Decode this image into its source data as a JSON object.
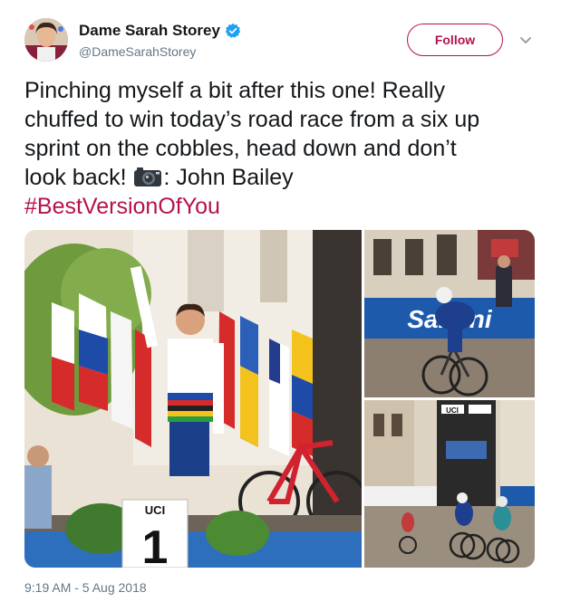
{
  "user": {
    "display_name": "Dame Sarah Storey",
    "handle": "@DameSarahStorey",
    "verified": true
  },
  "follow_button": {
    "label": "Follow"
  },
  "tweet": {
    "line1": "Pinching myself a bit after this one! Really",
    "line2": "chuffed to win today’s road race from a six up",
    "line3": "sprint on the cobbles, head down and don’t",
    "line4": "look back!",
    "credit": ": John Bailey",
    "hashtag": "#BestVersionOfYou"
  },
  "media": {
    "podium_sign": "1",
    "uci_label": "UCI",
    "banner_text": "Santini",
    "truck_label": "UCI"
  },
  "timestamp": "9:19 AM - 5 Aug 2018",
  "colors": {
    "accent": "#b5124f",
    "text": "#14171a",
    "secondary": "#657786",
    "verified": "#1da1f2"
  },
  "icons": {
    "verified": "verified-badge-icon",
    "caret": "chevron-down-icon",
    "camera": "camera-emoji-icon"
  }
}
